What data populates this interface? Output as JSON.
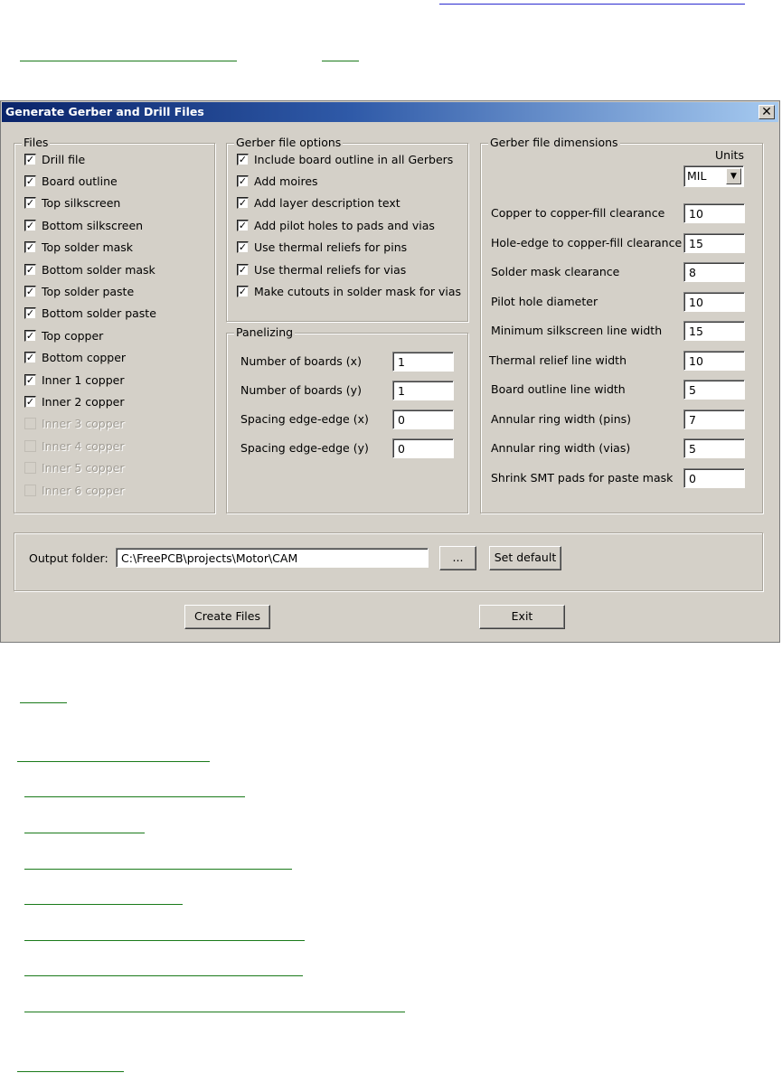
{
  "dialog": {
    "title": "Generate Gerber and Drill Files",
    "close_glyph": "✕"
  },
  "files": {
    "legend": "Files",
    "items": [
      {
        "label": "Drill file",
        "checked": true,
        "enabled": true
      },
      {
        "label": "Board outline",
        "checked": true,
        "enabled": true
      },
      {
        "label": "Top silkscreen",
        "checked": true,
        "enabled": true
      },
      {
        "label": "Bottom silkscreen",
        "checked": true,
        "enabled": true
      },
      {
        "label": "Top solder mask",
        "checked": true,
        "enabled": true
      },
      {
        "label": "Bottom solder mask",
        "checked": true,
        "enabled": true
      },
      {
        "label": "Top solder paste",
        "checked": true,
        "enabled": true
      },
      {
        "label": "Bottom solder paste",
        "checked": true,
        "enabled": true
      },
      {
        "label": "Top copper",
        "checked": true,
        "enabled": true
      },
      {
        "label": "Bottom copper",
        "checked": true,
        "enabled": true
      },
      {
        "label": "Inner 1 copper",
        "checked": true,
        "enabled": true
      },
      {
        "label": "Inner 2 copper",
        "checked": true,
        "enabled": true
      },
      {
        "label": "Inner 3 copper",
        "checked": false,
        "enabled": false
      },
      {
        "label": "Inner 4 copper",
        "checked": false,
        "enabled": false
      },
      {
        "label": "Inner 5 copper",
        "checked": false,
        "enabled": false
      },
      {
        "label": "Inner 6 copper",
        "checked": false,
        "enabled": false
      }
    ]
  },
  "gerber_options": {
    "legend": "Gerber file options",
    "items": [
      {
        "label": "Include board outline in all Gerbers",
        "checked": true
      },
      {
        "label": "Add moires",
        "checked": true
      },
      {
        "label": "Add layer description text",
        "checked": true
      },
      {
        "label": "Add pilot holes to pads and vias",
        "checked": true
      },
      {
        "label": "Use thermal reliefs for pins",
        "checked": true
      },
      {
        "label": "Use thermal reliefs for vias",
        "checked": true
      },
      {
        "label": "Make cutouts in solder mask for vias",
        "checked": true
      }
    ]
  },
  "panelizing": {
    "legend": "Panelizing",
    "fields": [
      {
        "label": "Number of boards (x)",
        "value": "1"
      },
      {
        "label": "Number of boards (y)",
        "value": "1"
      },
      {
        "label": "Spacing edge-edge (x)",
        "value": "0"
      },
      {
        "label": "Spacing edge-edge (y)",
        "value": "0"
      }
    ]
  },
  "dimensions": {
    "legend": "Gerber file dimensions",
    "units_label": "Units",
    "units_value": "MIL",
    "fields": [
      {
        "label": "Copper to copper-fill clearance",
        "value": "10"
      },
      {
        "label": "Hole-edge to copper-fill clearance",
        "value": "15"
      },
      {
        "label": "Solder mask clearance",
        "value": "8"
      },
      {
        "label": "Pilot hole diameter",
        "value": "10"
      },
      {
        "label": "Minimum silkscreen line width",
        "value": "15"
      },
      {
        "label": "Thermal relief line width",
        "value": "10"
      },
      {
        "label": "Board outline line width",
        "value": "5"
      },
      {
        "label": "Annular ring width (pins)",
        "value": "7"
      },
      {
        "label": "Annular ring width (vias)",
        "value": "5"
      },
      {
        "label": "Shrink SMT pads for paste mask",
        "value": "0"
      }
    ]
  },
  "output": {
    "label": "Output folder:",
    "path": "C:\\FreePCB\\projects\\Motor\\CAM",
    "browse_label": "...",
    "set_default_label": "Set default"
  },
  "buttons": {
    "create_files": "Create Files",
    "exit": "Exit"
  },
  "colors": {
    "link_green": "#1a7a1a",
    "link_blue": "#2a2ad0",
    "dialog_face": "#d4d0c8",
    "title_dark": "#0a246a",
    "title_light": "#a6caf0"
  }
}
